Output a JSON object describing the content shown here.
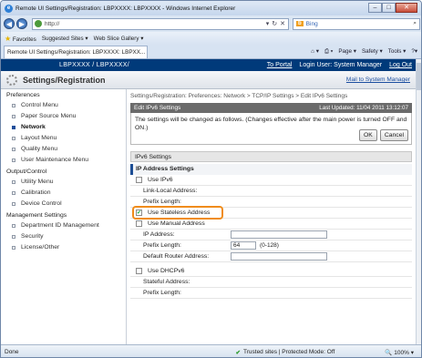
{
  "browser": {
    "title": "Remote UI Settings/Registration: LBPXXXX: LBPXXXX - Windows Internet Explorer",
    "address": "http://",
    "search_engine": "Bing",
    "favorites_label": "Favorites",
    "fav_links": [
      "Suggested Sites ▾",
      "Web Slice Gallery ▾"
    ],
    "tab_title": "Remote UI Settings/Registration: LBPXXXX: LBPXX...",
    "commands": [
      "Page ▾",
      "Safety ▾",
      "Tools ▾"
    ],
    "status_left": "Done",
    "status_zone": "Trusted sites | Protected Mode: Off",
    "zoom": "100%"
  },
  "page": {
    "model": "LBPXXXX / LBPXXXX/",
    "to_portal": "To Portal",
    "login_user": "Login User: System Manager",
    "logout": "Log Out",
    "heading": "Settings/Registration",
    "mail_link": "Mail to System Manager"
  },
  "sidebar": {
    "sections": [
      {
        "title": "Preferences",
        "items": [
          "Control Menu",
          "Paper Source Menu",
          "Network",
          "Layout Menu",
          "Quality Menu",
          "User Maintenance Menu"
        ]
      },
      {
        "title": "Output/Control",
        "items": [
          "Utility Menu",
          "Calibration",
          "Device Control"
        ]
      },
      {
        "title": "Management Settings",
        "items": [
          "Department ID Management",
          "Security",
          "License/Other"
        ]
      }
    ],
    "active": "Network"
  },
  "main": {
    "breadcrumb": "Settings/Registration: Preferences: Network > TCP/IP Settings > Edit IPv6 Settings",
    "edit_title": "Edit IPv6 Settings",
    "last_updated": "Last Updated: 11/04 2011 13:12:07",
    "message": "The settings will be changed as follows. (Changes effective after the main power is turned OFF and ON.)",
    "ok": "OK",
    "cancel": "Cancel",
    "ipv6_settings": "IPv6 Settings",
    "ip_address_settings": "IP Address Settings",
    "use_ipv6": "Use IPv6",
    "link_local": "Link-Local Address:",
    "prefix_length": "Prefix Length:",
    "use_stateless": "Use Stateless Address",
    "use_manual": "Use Manual Address",
    "ip_address": "IP Address:",
    "prefix_length_value": "64",
    "prefix_range": "(0-128)",
    "default_router": "Default Router Address:",
    "use_dhcpv6": "Use DHCPv6",
    "stateful": "Stateful Address:",
    "prefix_length2": "Prefix Length:"
  }
}
